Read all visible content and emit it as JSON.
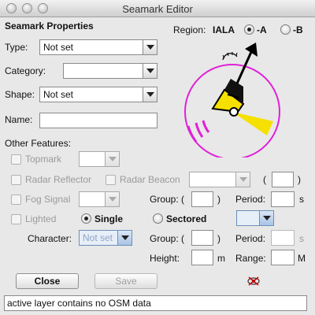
{
  "window": {
    "title": "Seamark Editor"
  },
  "section_title": "Seamark Properties",
  "region": {
    "label": "Region:",
    "iala": "IALA",
    "option_a": "-A",
    "option_b": "-B",
    "selected": "A"
  },
  "type": {
    "label": "Type:",
    "value": "Not set"
  },
  "category": {
    "label": "Category:",
    "value": ""
  },
  "shape": {
    "label": "Shape:",
    "value": "Not set"
  },
  "name": {
    "label": "Name:",
    "value": ""
  },
  "other_features": {
    "title": "Other Features:",
    "topmark": "Topmark",
    "radar_reflector": "Radar Reflector",
    "radar_beacon": "Radar Beacon",
    "paren_open": "(",
    "paren_close": ")",
    "fog_signal": "Fog Signal",
    "group_label": "Group: (",
    "period_label": "Period:",
    "seconds_unit": "s",
    "lighted": "Lighted",
    "single": "Single",
    "sectored": "Sectored",
    "character_label": "Character:",
    "character_value": "Not set",
    "height_label": "Height:",
    "height_unit": "m",
    "range_label": "Range:",
    "range_unit": "M"
  },
  "buttons": {
    "close": "Close",
    "save": "Save"
  },
  "status": "active layer contains no OSM data",
  "icons": {
    "preview": "buoy-light-preview-icon",
    "osm": "osm-eye-icon"
  },
  "colors": {
    "magenta": "#e020d8",
    "yellow": "#f5e000",
    "black": "#000000"
  }
}
